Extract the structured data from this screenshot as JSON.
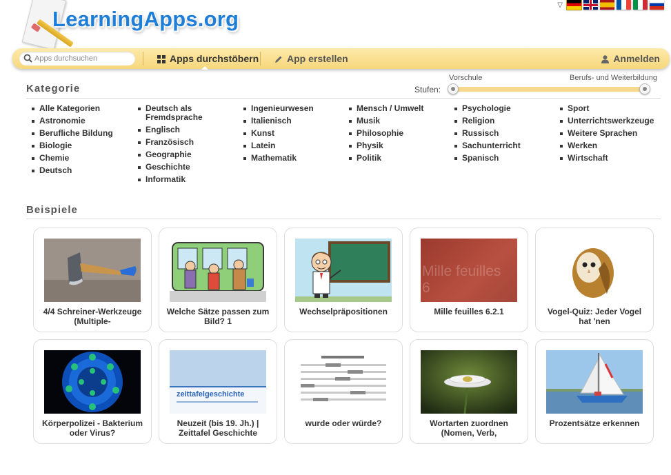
{
  "site": {
    "logo_text": "LearningApps.org"
  },
  "languages": [
    "de",
    "gb",
    "es",
    "fr",
    "it",
    "ru"
  ],
  "nav": {
    "search_placeholder": "Apps durchsuchen",
    "browse_label": "Apps durchstöbern",
    "create_label": "App erstellen",
    "login_label": "Anmelden"
  },
  "categories": {
    "title": "Kategorie",
    "level_label": "Stufen:",
    "level_min_label": "Vorschule",
    "level_max_label": "Berufs- und Weiterbildung",
    "columns": [
      [
        "Alle Kategorien",
        "Astronomie",
        "Berufliche Bildung",
        "Biologie",
        "Chemie",
        "Deutsch"
      ],
      [
        "Deutsch als Fremdsprache",
        "Englisch",
        "Französisch",
        "Geographie",
        "Geschichte",
        "Informatik"
      ],
      [
        "Ingenieurwesen",
        "Italienisch",
        "Kunst",
        "Latein",
        "Mathematik"
      ],
      [
        "Mensch / Umwelt",
        "Musik",
        "Philosophie",
        "Physik",
        "Politik"
      ],
      [
        "Psychologie",
        "Religion",
        "Russisch",
        "Sachunterricht",
        "Spanisch"
      ],
      [
        "Sport",
        "Unterrichtswerkzeuge",
        "Weitere Sprachen",
        "Werken",
        "Wirtschaft"
      ]
    ]
  },
  "examples": {
    "title": "Beispiele",
    "items": [
      {
        "caption": "4/4 Schreiner-Werkzeuge (Multiple-",
        "thumb": "axe"
      },
      {
        "caption": "Welche Sätze passen zum Bild? 1",
        "thumb": "train"
      },
      {
        "caption": "Wechselpräpositionen",
        "thumb": "teacher"
      },
      {
        "caption": "Mille feuilles 6.2.1",
        "thumb": "mille",
        "thumb_text": "Mille feuilles 6"
      },
      {
        "caption": "Vogel-Quiz: Jeder Vogel hat 'nen",
        "thumb": "owl"
      },
      {
        "caption": "Körperpolizei - Bakterium oder Virus?",
        "thumb": "virus"
      },
      {
        "caption": "Neuzeit (bis 19. Jh.) | Zeittafel Geschichte",
        "thumb": "zeittafel",
        "thumb_text": "zeittafelgeschichte"
      },
      {
        "caption": "wurde oder würde?",
        "thumb": "gaps"
      },
      {
        "caption": "Wortarten zuordnen (Nomen, Verb,",
        "thumb": "flower"
      },
      {
        "caption": "Prozentsätze erkennen",
        "thumb": "boat"
      }
    ]
  }
}
